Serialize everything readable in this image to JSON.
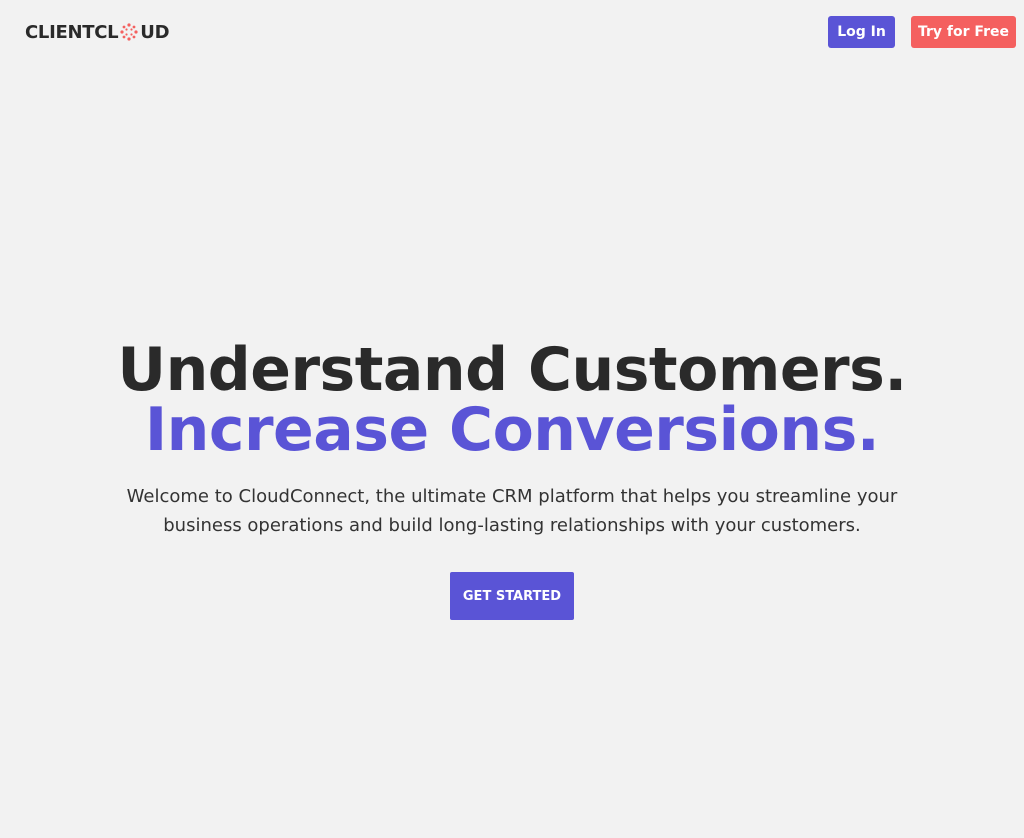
{
  "header": {
    "logo": {
      "text_before": "CLIENTCL",
      "text_after": "UD",
      "icon": "burst-icon",
      "icon_color": "#f4605f"
    },
    "login_label": "Log In",
    "try_label": "Try for Free"
  },
  "hero": {
    "headline_line1": "Understand Customers.",
    "headline_line2": "Increase Conversions.",
    "subtitle": "Welcome to CloudConnect, the ultimate CRM platform that helps you streamline your business operations and build long-lasting relationships with your customers.",
    "cta_label": "GET STARTED"
  },
  "colors": {
    "background": "#f2f2f2",
    "primary": "#5a54d6",
    "accent": "#f4605f",
    "text": "#2a2a2a"
  }
}
